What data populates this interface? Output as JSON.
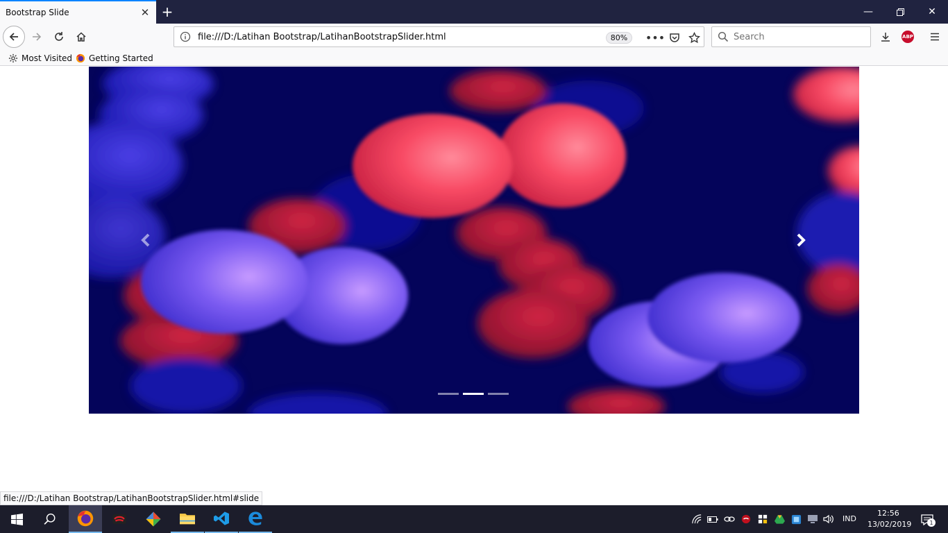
{
  "browser": {
    "tab_title": "Bootstrap Slide",
    "new_tab_icon": "plus-icon",
    "url": "file:///D:/Latihan Bootstrap/LatihanBootstrapSlider.html",
    "zoom": "80%",
    "search_placeholder": "Search",
    "abp_label": "ABP",
    "accent": "#0a84ff",
    "titlebar_color": "#202340"
  },
  "bookmarks": {
    "items": [
      {
        "label": "Most Visited",
        "icon": "gear-icon"
      },
      {
        "label": "Getting Started",
        "icon": "firefox-icon"
      }
    ]
  },
  "carousel": {
    "slide_count": 3,
    "active_index": 1,
    "prev_icon": "chevron-left-icon",
    "next_icon": "chevron-right-icon"
  },
  "status_bar": {
    "text": "file:///D:/Latihan Bootstrap/LatihanBootstrapSlider.html#slide"
  },
  "taskbar": {
    "apps": [
      {
        "name": "windows-start-icon"
      },
      {
        "name": "search-icon"
      },
      {
        "name": "firefox-icon"
      },
      {
        "name": "game-app-icon"
      },
      {
        "name": "git-app-icon"
      },
      {
        "name": "file-explorer-icon"
      },
      {
        "name": "vscode-icon"
      },
      {
        "name": "edge-icon"
      }
    ],
    "language": "IND",
    "time": "12:56",
    "date": "13/02/2019",
    "notification_count": "1"
  }
}
